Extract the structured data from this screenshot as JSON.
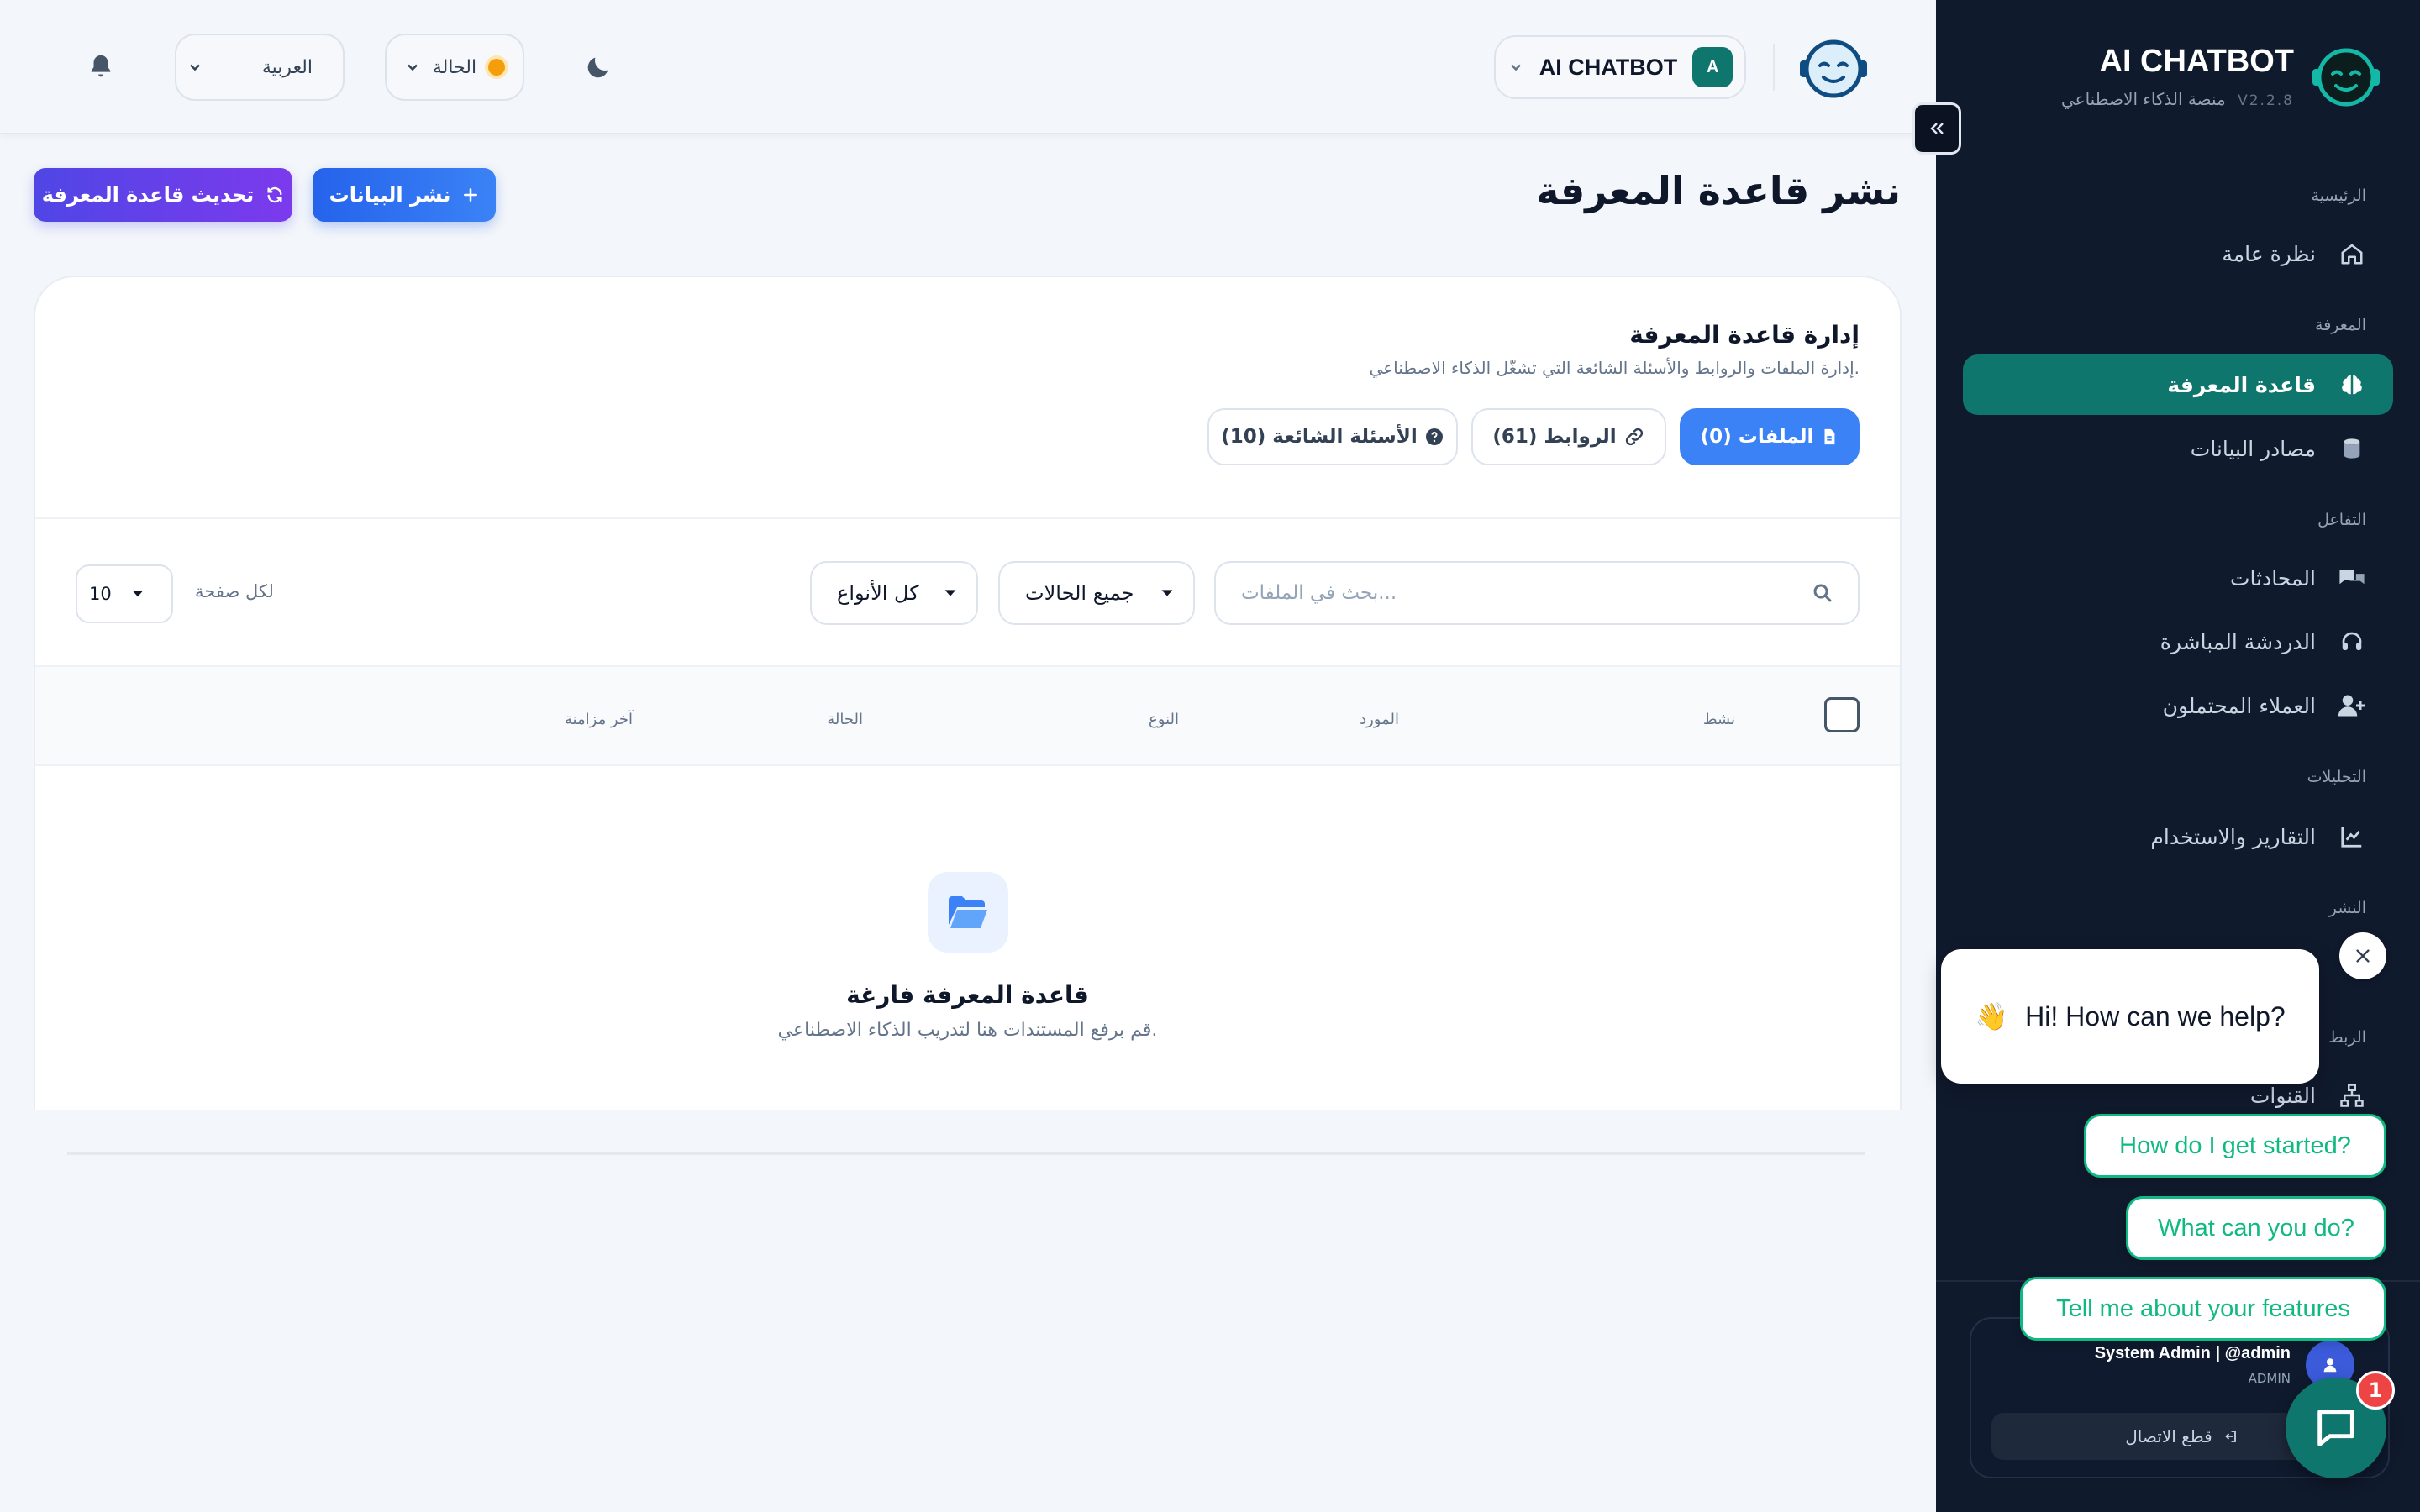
{
  "topbar": {
    "language": "العربية",
    "status_label": "الحالة",
    "app_name": "AI CHATBOT",
    "user_initial": "A"
  },
  "page": {
    "title": "نشر قاعدة المعرفة",
    "refresh_button": "تحديث قاعدة المعرفة",
    "publish_button": "نشر البيانات"
  },
  "card": {
    "title": "إدارة قاعدة المعرفة",
    "subtitle": "إدارة الملفات والروابط والأسئلة الشائعة التي تشغّل الذكاء الاصطناعي.",
    "tabs": [
      {
        "label": "الملفات (0)",
        "icon": "file-icon",
        "active": true
      },
      {
        "label": "الروابط (61)",
        "icon": "link-icon",
        "active": false
      },
      {
        "label": "الأسئلة الشائعة (10)",
        "icon": "question-icon",
        "active": false
      }
    ],
    "search_placeholder": "بحث في الملفات...",
    "status_filter": "جميع الحالات",
    "type_filter": "كل الأنواع",
    "per_page_label": "لكل صفحة",
    "per_page_value": "10",
    "columns": [
      "نشط",
      "المورد",
      "النوع",
      "الحالة",
      "آخر مزامنة"
    ],
    "empty_title": "قاعدة المعرفة فارغة",
    "empty_subtitle": "قم برفع المستندات هنا لتدريب الذكاء الاصطناعي."
  },
  "sidebar": {
    "brand": "AI CHATBOT",
    "subtitle": "منصة الذكاء الاصطناعي",
    "version": "V2.2.8",
    "sections": {
      "home": "الرئيسية",
      "knowledge": "المعرفة",
      "interaction": "التفاعل",
      "analytics": "التحليلات",
      "publish": "النشر",
      "integration": "الربط"
    },
    "items": {
      "overview": "نظرة عامة",
      "knowledge_base": "قاعدة المعرفة",
      "data_sources": "مصادر البيانات",
      "conversations": "المحادثات",
      "live_chat": "الدردشة المباشرة",
      "leads": "العملاء المحتملون",
      "reports": "التقارير والاستخدام",
      "channels": "القنوات"
    },
    "user": {
      "name": "System Admin | @admin",
      "role": "ADMIN",
      "logout": "قطع الاتصال"
    }
  },
  "chat_widget": {
    "greeting": "Hi! How can we help?",
    "wave": "👋",
    "suggestions": [
      "How do I get started?",
      "What can you do?",
      "Tell me about your features"
    ],
    "badge_count": "1"
  },
  "colors": {
    "accent_teal": "#0f766e",
    "primary_blue": "#3b82f6",
    "indigo": "#4f46e5",
    "sidebar_bg": "#101a2d",
    "suggestion_green": "#10b981",
    "badge_red": "#ef4444",
    "status_amber": "#f59e0b"
  }
}
